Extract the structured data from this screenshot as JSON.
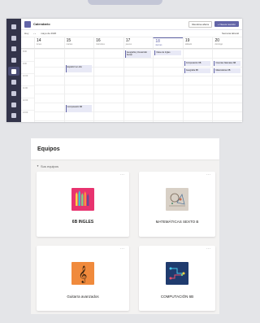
{
  "calendar": {
    "title": "Calendario",
    "meet_now_label": "Reunirse ahora",
    "new_meeting_label": "+ Nueva reunión",
    "today_label": "Hoy",
    "month_label": "mayo de 2020",
    "view_label": "Semana laboral",
    "days": [
      {
        "num": "14",
        "name": "lunes"
      },
      {
        "num": "15",
        "name": "martes"
      },
      {
        "num": "16",
        "name": "miércoles"
      },
      {
        "num": "17",
        "name": "jueves"
      },
      {
        "num": "18",
        "name": "viernes"
      },
      {
        "num": "19",
        "name": "sábado"
      },
      {
        "num": "20",
        "name": "domingo"
      }
    ],
    "times": [
      "8:00",
      "9:00",
      "10:00",
      "11:00",
      "12:00",
      "13:00"
    ],
    "events": [
      {
        "text": "Español 1er año"
      },
      {
        "text": "Computación 6B"
      },
      {
        "text": "Geografía y Desarrollo Social"
      },
      {
        "text": "Clase de Ingles"
      },
      {
        "text": "Computación 6B"
      },
      {
        "text": "Geografía 6B"
      },
      {
        "text": "Ciencias Naturales 6B"
      },
      {
        "text": "Matemáticas 6B"
      }
    ]
  },
  "teams": {
    "title": "Equipos",
    "section_label": "Sus equipos",
    "cards": [
      {
        "name": "6B INGLES",
        "icon": "crayons-icon",
        "bg": "#e8336f"
      },
      {
        "name": "MATEMÁTICAS SEXTO B",
        "icon": "math-drawing-icon",
        "bg": "#d8d0c6"
      },
      {
        "name": "Guitarra avanzados",
        "icon": "treble-clef-icon",
        "bg": "#f08a3c"
      },
      {
        "name": "COMPUTACIÓN 6B",
        "icon": "circuit-icon",
        "bg": "#1f3b6e"
      }
    ]
  }
}
